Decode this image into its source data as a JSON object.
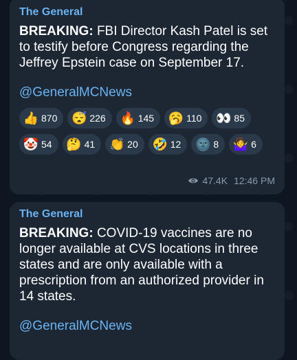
{
  "messages": [
    {
      "author": "The General",
      "lead": "BREAKING:",
      "text": " FBI Director Kash Patel is set to testify before Congress regarding the Jeffrey Epstein case on September 17.",
      "handle": "@GeneralMCNews",
      "reactions": [
        {
          "emoji": "👍",
          "count": "870"
        },
        {
          "emoji": "😴",
          "count": "226"
        },
        {
          "emoji": "🔥",
          "count": "145"
        },
        {
          "emoji": "🥱",
          "count": "110"
        },
        {
          "emoji": "👀",
          "count": "85"
        },
        {
          "emoji": "🤡",
          "count": "54"
        },
        {
          "emoji": "🤔",
          "count": "41"
        },
        {
          "emoji": "👏",
          "count": "20"
        },
        {
          "emoji": "🤣",
          "count": "12"
        },
        {
          "emoji": "🌚",
          "count": "8"
        },
        {
          "emoji": "🤷‍♀️",
          "count": "6"
        }
      ],
      "views": "47.4K",
      "time": "12:46 PM"
    },
    {
      "author": "The General",
      "lead": "BREAKING:",
      "text": " COVID-19 vaccines are no longer available at CVS locations in three states and are only available with a prescription from an authorized provider in 14 states.",
      "handle": "@GeneralMCNews"
    }
  ]
}
